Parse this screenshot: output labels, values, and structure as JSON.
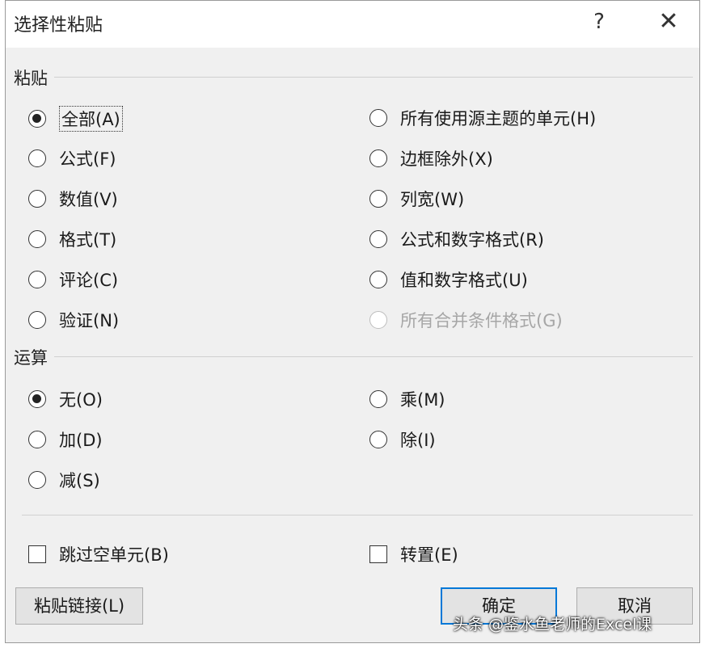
{
  "window": {
    "title": "选择性粘贴",
    "help_glyph": "?",
    "close_glyph": "✕"
  },
  "paste_group": {
    "label": "粘贴",
    "options": [
      {
        "label": "全部(A)",
        "checked": true,
        "disabled": false
      },
      {
        "label": "公式(F)",
        "checked": false,
        "disabled": false
      },
      {
        "label": "数值(V)",
        "checked": false,
        "disabled": false
      },
      {
        "label": "格式(T)",
        "checked": false,
        "disabled": false
      },
      {
        "label": "评论(C)",
        "checked": false,
        "disabled": false
      },
      {
        "label": "验证(N)",
        "checked": false,
        "disabled": false
      },
      {
        "label": "所有使用源主题的单元(H)",
        "checked": false,
        "disabled": false
      },
      {
        "label": "边框除外(X)",
        "checked": false,
        "disabled": false
      },
      {
        "label": "列宽(W)",
        "checked": false,
        "disabled": false
      },
      {
        "label": "公式和数字格式(R)",
        "checked": false,
        "disabled": false
      },
      {
        "label": "值和数字格式(U)",
        "checked": false,
        "disabled": false
      },
      {
        "label": "所有合并条件格式(G)",
        "checked": false,
        "disabled": true
      }
    ]
  },
  "operation_group": {
    "label": "运算",
    "options": [
      {
        "label": "无(O)",
        "checked": true
      },
      {
        "label": "加(D)",
        "checked": false
      },
      {
        "label": "减(S)",
        "checked": false
      },
      {
        "label": "乘(M)",
        "checked": false
      },
      {
        "label": "除(I)",
        "checked": false
      }
    ]
  },
  "checkboxes": {
    "skip_blanks": {
      "label": "跳过空单元(B)",
      "checked": false
    },
    "transpose": {
      "label": "转置(E)",
      "checked": false
    }
  },
  "buttons": {
    "paste_link": "粘贴链接(L)",
    "ok": "确定",
    "cancel": "取消"
  },
  "watermark": "头条 @鉴水鱼老师的Excel课"
}
